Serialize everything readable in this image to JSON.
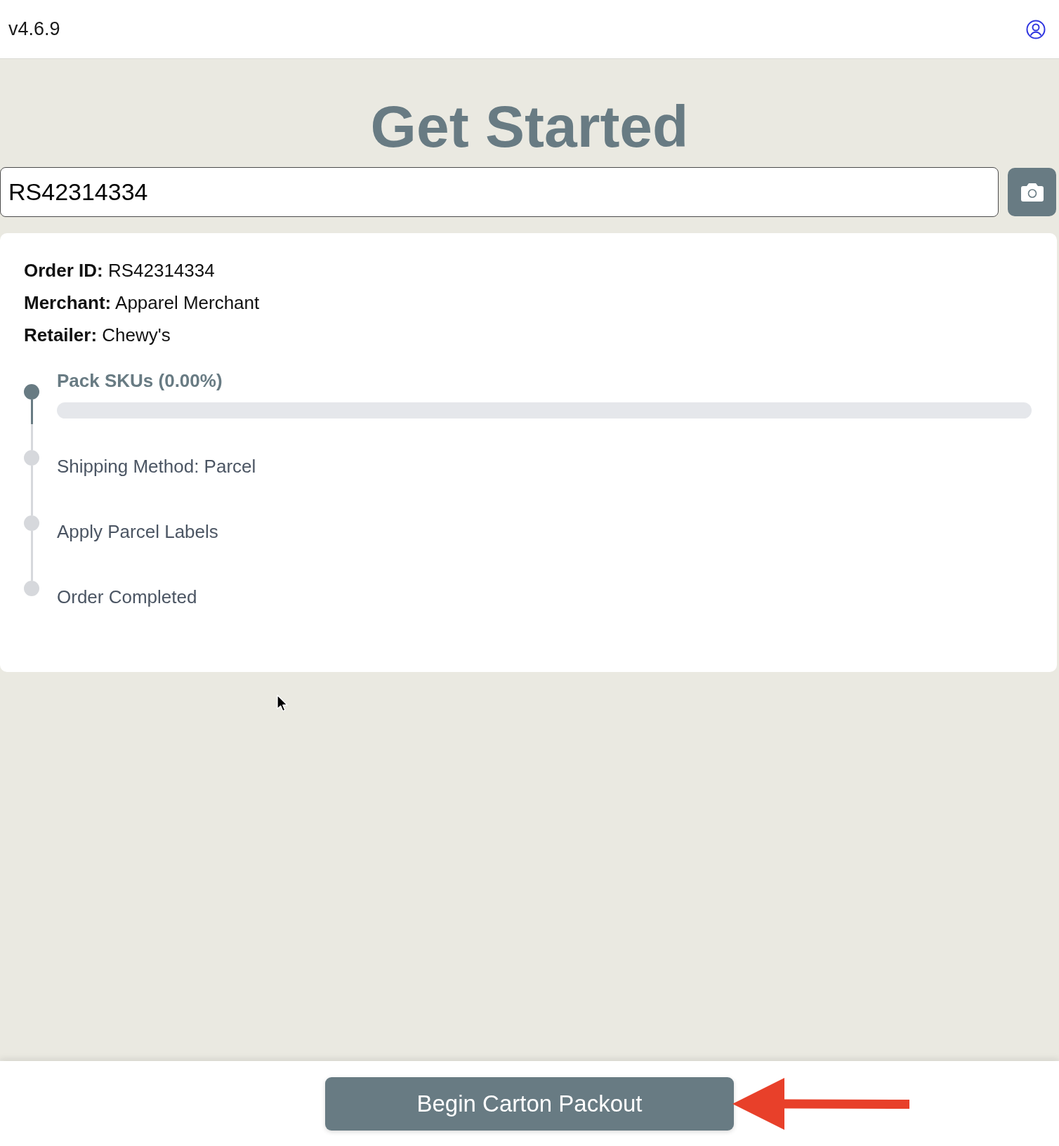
{
  "header": {
    "version": "v4.6.9"
  },
  "title": "Get Started",
  "order_search": {
    "value": "RS42314334"
  },
  "order_details": [
    {
      "label": "Order ID:",
      "value": "RS42314334"
    },
    {
      "label": "Merchant:",
      "value": "Apparel Merchant"
    },
    {
      "label": "Retailer:",
      "value": "Chewy's"
    }
  ],
  "steps": [
    {
      "kind": "progress",
      "label": "Pack SKUs (0.00%)",
      "active": true,
      "level": 0
    },
    {
      "kind": "plain",
      "label": "Shipping Method: Parcel",
      "active": false
    },
    {
      "kind": "plain",
      "label": "Apply Parcel Labels",
      "active": false
    },
    {
      "kind": "plain",
      "label": "Order Completed",
      "active": false
    }
  ],
  "footer": {
    "button": "Begin Carton Packout"
  }
}
